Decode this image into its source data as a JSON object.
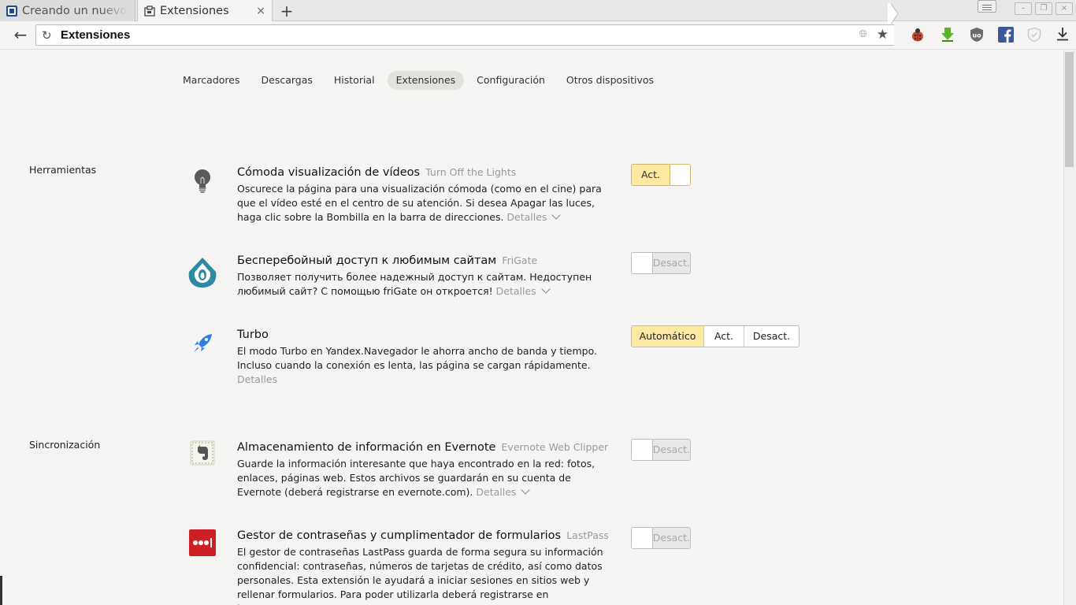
{
  "tabs": [
    {
      "title": "Creando un nuevo",
      "active": false
    },
    {
      "title": "Extensiones",
      "active": true,
      "close": "×"
    }
  ],
  "new_tab": "+",
  "window_controls": [
    "–",
    "❐",
    "×"
  ],
  "address_bar": {
    "text": "Extensiones"
  },
  "toolbar_icons": [
    "ladybug-icon",
    "download-arrow-icon",
    "ublock-icon",
    "facebook-icon",
    "shield-icon"
  ],
  "nav": {
    "items": [
      "Marcadores",
      "Descargas",
      "Historial",
      "Extensiones",
      "Configuración",
      "Otros dispositivos"
    ],
    "active_index": 3
  },
  "sections": {
    "tools": "Herramientas",
    "sync": "Sincronización"
  },
  "extensions": [
    {
      "title": "Cómoda visualización de vídeos",
      "subtitle": "Turn Off the Lights",
      "description": "Oscurece la página para una visualización cómoda (como en el cine) para que el vídeo esté en el centro de su atención. Si desea Apagar las luces, haga clic sobre la Bombilla en la barra de direcciones.",
      "details": "Detalles",
      "state": "Act."
    },
    {
      "title": "Бесперебойный доступ к любимым сайтам",
      "subtitle": "FriGate",
      "description": "Позволяет получить более надежный доступ к сайтам. Недоступен любимый сайт? С помощью friGate он откроется!",
      "details": "Detalles",
      "state": "Desact."
    },
    {
      "title": "Turbo",
      "subtitle": "",
      "description": "El modo Turbo en Yandex.Navegador le ahorra ancho de banda y tiempo. Incluso cuando la conexión es lenta, las página se cargan rápidamente.",
      "details": "Detalles",
      "options": [
        "Automático",
        "Act.",
        "Desact."
      ],
      "selected": "Automático"
    },
    {
      "title": "Almacenamiento de información en Evernote",
      "subtitle": "Evernote Web Clipper",
      "description": "Guarde la información interesante que haya encontrado en la red: fotos, enlaces, páginas web. Estos archivos se guardarán en su cuenta de Evernote (deberá registrarse en evernote.com).",
      "details": "Detalles",
      "state": "Desact."
    },
    {
      "title": "Gestor de contraseñas y cumplimentador de formularios",
      "subtitle": "LastPass",
      "description": "El gestor de contraseñas LastPass guarda de forma segura su información confidencial: contraseñas, números de tarjetas de crédito, así como datos personales. Esta extensión le ayudará a iniciar sesiones en sitios web y rellenar formularios. Para poder utilizarla deberá registrarse en lastpass.com.",
      "state": "Desact."
    }
  ],
  "colors": {
    "accent_on": "#fde9a1",
    "background": "#f5f4f2"
  }
}
